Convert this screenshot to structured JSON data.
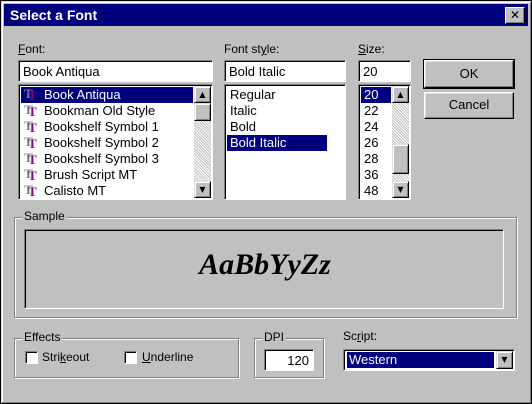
{
  "window": {
    "title": "Select a Font",
    "close_glyph": "✕"
  },
  "font": {
    "label_key": "F",
    "label_rest": "ont:",
    "value": "Book Antiqua",
    "items": [
      "Book Antiqua",
      "Bookman Old Style",
      "Bookshelf Symbol 1",
      "Bookshelf Symbol 2",
      "Bookshelf Symbol 3",
      "Brush Script MT",
      "Calisto MT"
    ],
    "selected_index": 0
  },
  "style": {
    "label_pre": "Font st",
    "label_key": "y",
    "label_post": "le:",
    "value": "Bold Italic",
    "items": [
      "Regular",
      "Italic",
      "Bold",
      "Bold Italic"
    ],
    "selected_index": 3
  },
  "size": {
    "label_key": "S",
    "label_rest": "ize:",
    "value": "20",
    "items": [
      "20",
      "22",
      "24",
      "26",
      "28",
      "36",
      "48"
    ],
    "selected_index": 0
  },
  "buttons": {
    "ok": "OK",
    "cancel": "Cancel"
  },
  "sample": {
    "title": "Sample",
    "text": "AaBbYyZz"
  },
  "effects": {
    "title": "Effects",
    "strikeout_pre": "Stri",
    "strikeout_key": "k",
    "strikeout_post": "eout",
    "underline_key": "U",
    "underline_rest": "nderline",
    "strikeout_checked": false,
    "underline_checked": false
  },
  "dpi": {
    "title": "DPI",
    "value": "120"
  },
  "script": {
    "label_pre": "Sc",
    "label_key": "r",
    "label_post": "ipt:",
    "value": "Western"
  },
  "icons": {
    "scroll_up": "▲",
    "scroll_down": "▼",
    "combo_arrow": "▼",
    "truetype": "truetype-font-icon"
  },
  "colors": {
    "face": "#c0c0c0",
    "title_bar": "#00007e",
    "highlight": "#00007e",
    "truetype_purple": "#800080"
  }
}
